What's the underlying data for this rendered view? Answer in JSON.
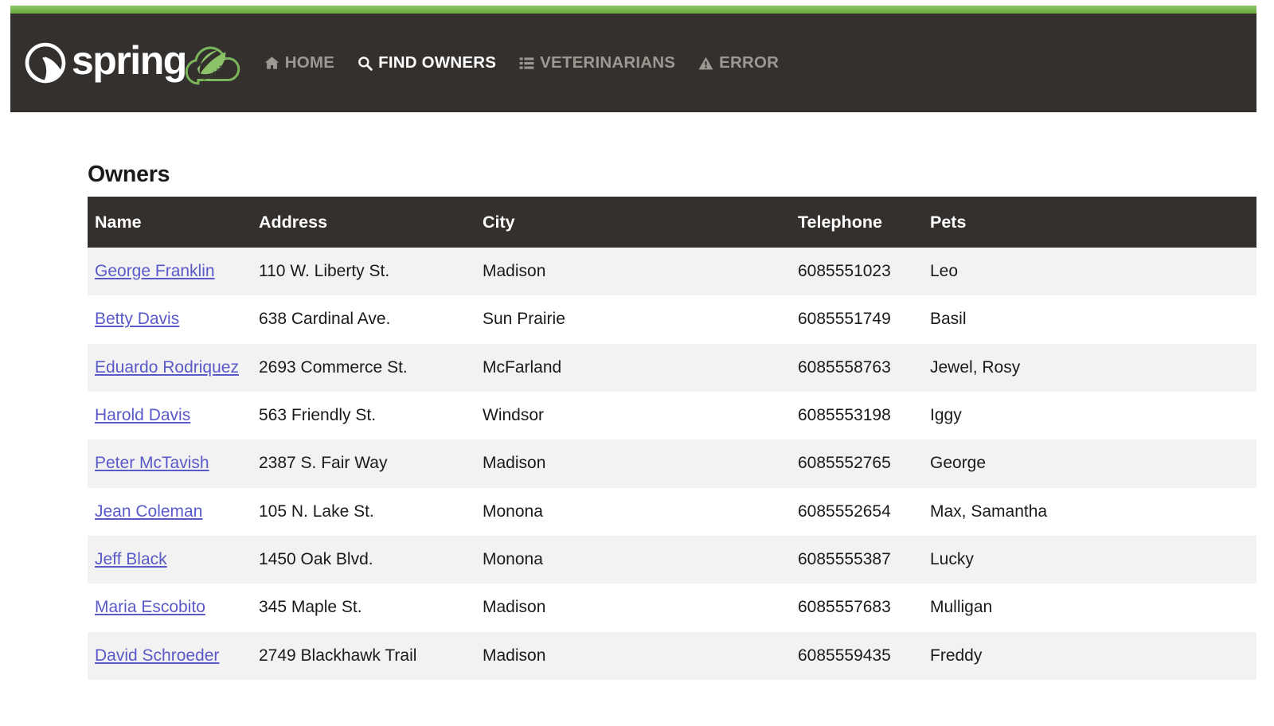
{
  "navbar": {
    "brand": {
      "name": "spring",
      "logo_icon": "spring-leaf-logo-icon",
      "cloud_icon": "spring-cloud-logo-icon"
    },
    "accent_color": "#6db33f",
    "background_color": "#34302d",
    "links": [
      {
        "label": "HOME",
        "icon": "home-icon",
        "active": false
      },
      {
        "label": "FIND OWNERS",
        "icon": "search-icon",
        "active": true
      },
      {
        "label": "VETERINARIANS",
        "icon": "list-icon",
        "active": false
      },
      {
        "label": "ERROR",
        "icon": "warning-triangle-icon",
        "active": false
      }
    ]
  },
  "main": {
    "title": "Owners",
    "table": {
      "columns": [
        "Name",
        "Address",
        "City",
        "Telephone",
        "Pets"
      ],
      "rows": [
        {
          "name": "George Franklin",
          "address": "110 W. Liberty St.",
          "city": "Madison",
          "telephone": "6085551023",
          "pets": "Leo"
        },
        {
          "name": "Betty Davis",
          "address": "638 Cardinal Ave.",
          "city": "Sun Prairie",
          "telephone": "6085551749",
          "pets": "Basil"
        },
        {
          "name": "Eduardo Rodriquez",
          "address": "2693 Commerce St.",
          "city": "McFarland",
          "telephone": "6085558763",
          "pets": "Jewel, Rosy"
        },
        {
          "name": "Harold Davis",
          "address": "563 Friendly St.",
          "city": "Windsor",
          "telephone": "6085553198",
          "pets": "Iggy"
        },
        {
          "name": "Peter McTavish",
          "address": "2387 S. Fair Way",
          "city": "Madison",
          "telephone": "6085552765",
          "pets": "George"
        },
        {
          "name": "Jean Coleman",
          "address": "105 N. Lake St.",
          "city": "Monona",
          "telephone": "6085552654",
          "pets": "Max, Samantha"
        },
        {
          "name": "Jeff Black",
          "address": "1450 Oak Blvd.",
          "city": "Monona",
          "telephone": "6085555387",
          "pets": "Lucky"
        },
        {
          "name": "Maria Escobito",
          "address": "345 Maple St.",
          "city": "Madison",
          "telephone": "6085557683",
          "pets": "Mulligan"
        },
        {
          "name": "David Schroeder",
          "address": "2749 Blackhawk Trail",
          "city": "Madison",
          "telephone": "6085559435",
          "pets": "Freddy"
        }
      ]
    }
  }
}
